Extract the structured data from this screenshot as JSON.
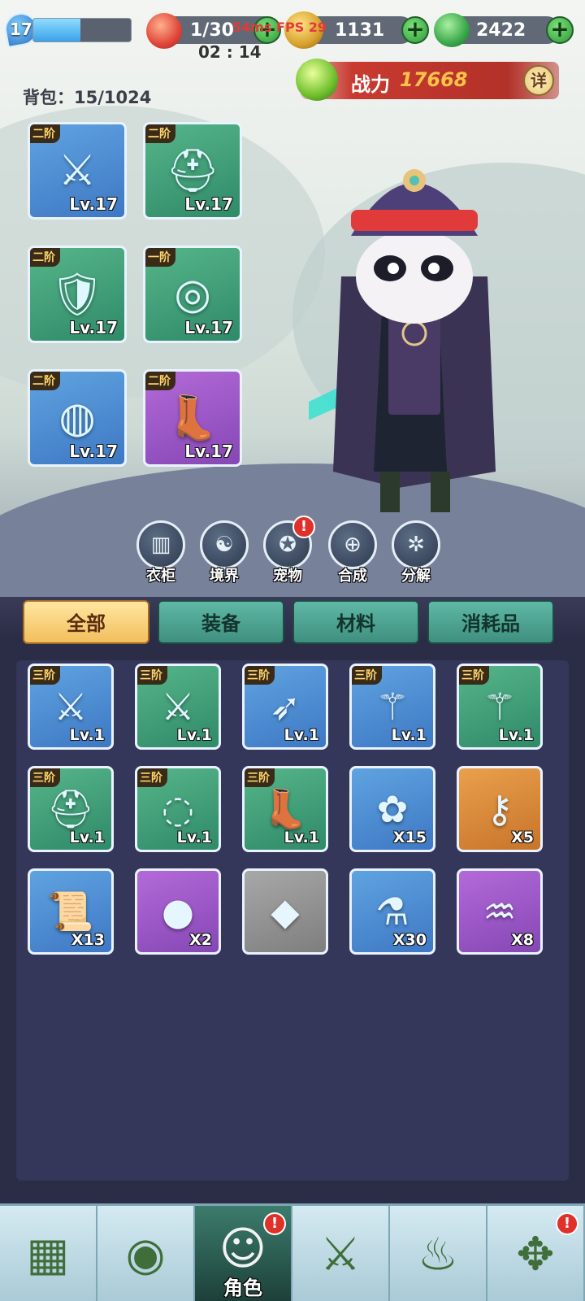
{
  "player": {
    "level": "17",
    "xp_fraction": 0.48
  },
  "resources": {
    "stamina": "1/30",
    "coins": "1131",
    "jade": "2422"
  },
  "network": {
    "info": "54ms  FPS 29"
  },
  "timer": "02 : 14",
  "bag": {
    "label": "背包：",
    "count": "15/1024"
  },
  "power": {
    "label": "战力",
    "value": "17668",
    "detail_button": "详"
  },
  "equipped": [
    {
      "tier": "二阶",
      "level": "Lv.17",
      "color": "blue",
      "icon": "sword-icon"
    },
    {
      "tier": "二阶",
      "level": "Lv.17",
      "color": "green",
      "icon": "helmet-icon"
    },
    {
      "tier": "二阶",
      "level": "Lv.17",
      "color": "green",
      "icon": "armor-icon"
    },
    {
      "tier": "一阶",
      "level": "Lv.17",
      "color": "green",
      "icon": "belt-icon"
    },
    {
      "tier": "二阶",
      "level": "Lv.17",
      "color": "blue",
      "icon": "bracer-icon"
    },
    {
      "tier": "二阶",
      "level": "Lv.17",
      "color": "purple",
      "icon": "boots-icon"
    }
  ],
  "functions": [
    {
      "label": "衣柜",
      "icon": "wardrobe-icon",
      "alert": false
    },
    {
      "label": "境界",
      "icon": "realm-icon",
      "alert": false
    },
    {
      "label": "宠物",
      "icon": "pet-icon",
      "alert": true
    },
    {
      "label": "合成",
      "icon": "synthesis-icon",
      "alert": false
    },
    {
      "label": "分解",
      "icon": "decompose-icon",
      "alert": false
    }
  ],
  "tabs": [
    {
      "label": "全部",
      "active": true
    },
    {
      "label": "装备",
      "active": false
    },
    {
      "label": "材料",
      "active": false
    },
    {
      "label": "消耗品",
      "active": false
    }
  ],
  "alert_mark": "!",
  "inventory": [
    {
      "tier": "三阶",
      "badge": "Lv.1",
      "color": "blue",
      "icon": "sword-icon"
    },
    {
      "tier": "三阶",
      "badge": "Lv.1",
      "color": "green",
      "icon": "sword-icon"
    },
    {
      "tier": "三阶",
      "badge": "Lv.1",
      "color": "blue",
      "icon": "crossbow-icon"
    },
    {
      "tier": "三阶",
      "badge": "Lv.1",
      "color": "blue",
      "icon": "staff-icon"
    },
    {
      "tier": "三阶",
      "badge": "Lv.1",
      "color": "green",
      "icon": "staff-icon"
    },
    {
      "tier": "三阶",
      "badge": "Lv.1",
      "color": "green",
      "icon": "helmet-icon"
    },
    {
      "tier": "三阶",
      "badge": "Lv.1",
      "color": "green",
      "icon": "ring-icon"
    },
    {
      "tier": "三阶",
      "badge": "Lv.1",
      "color": "green",
      "icon": "boots-icon"
    },
    {
      "tier": "",
      "badge": "X15",
      "color": "blue",
      "icon": "lotus-icon"
    },
    {
      "tier": "",
      "badge": "X5",
      "color": "orange",
      "icon": "key-icon"
    },
    {
      "tier": "",
      "badge": "X13",
      "color": "blue",
      "icon": "scroll-icon"
    },
    {
      "tier": "",
      "badge": "X2",
      "color": "purple",
      "icon": "orb-box-icon"
    },
    {
      "tier": "",
      "badge": "",
      "color": "gray",
      "icon": "jade-shard-icon"
    },
    {
      "tier": "",
      "badge": "X30",
      "color": "blue",
      "icon": "potion-icon"
    },
    {
      "tier": "",
      "badge": "X8",
      "color": "purple",
      "icon": "comb-icon"
    }
  ],
  "bottom_nav": [
    {
      "label": "",
      "icon": "map-icon",
      "active": false,
      "alert": false
    },
    {
      "label": "",
      "icon": "frog-coin-icon",
      "active": false,
      "alert": false
    },
    {
      "label": "角色",
      "icon": "character-icon",
      "active": true,
      "alert": true
    },
    {
      "label": "",
      "icon": "crossed-swords-icon",
      "active": false,
      "alert": false
    },
    {
      "label": "",
      "icon": "gourd-icon",
      "active": false,
      "alert": false
    },
    {
      "label": "",
      "icon": "paw-shield-icon",
      "active": false,
      "alert": true
    }
  ]
}
